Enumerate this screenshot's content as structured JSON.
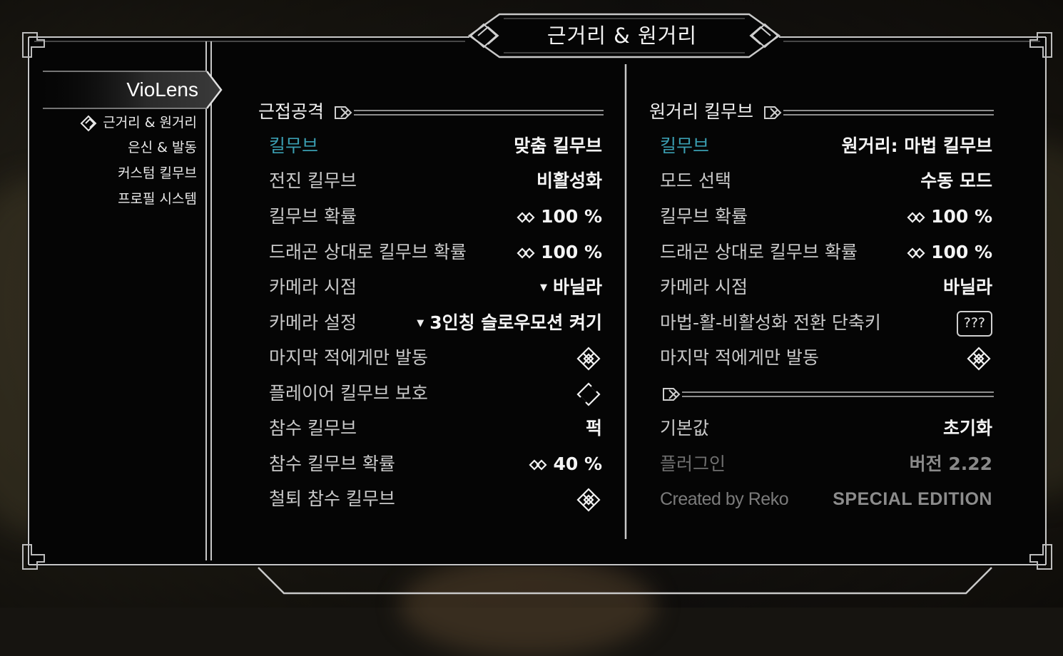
{
  "title": "근거리 & 원거리",
  "sidebar": {
    "brand": "VioLens",
    "items": [
      {
        "label": "근거리 & 원거리",
        "active": true
      },
      {
        "label": "은신 & 발동"
      },
      {
        "label": "커스텀 킬무브"
      },
      {
        "label": "프로필 시스템"
      }
    ]
  },
  "left_section": {
    "header": "근접공격",
    "rows": [
      {
        "label": "킬무브",
        "value": "맞춤 킬무브"
      },
      {
        "label": "전진 킬무브",
        "value": "비활성화"
      },
      {
        "label": "킬무브 확률",
        "value": "100 %"
      },
      {
        "label": "드래곤 상대로 킬무브 확률",
        "value": "100 %"
      },
      {
        "label": "카메라 시점",
        "value": "바닐라"
      },
      {
        "label": "카메라 설정",
        "value": "3인칭 슬로우모션 켜기"
      },
      {
        "label": "마지막 적에게만 발동",
        "value": ""
      },
      {
        "label": "플레이어 킬무브 보호",
        "value": ""
      },
      {
        "label": "참수 킬무브",
        "value": "퍽"
      },
      {
        "label": "참수 킬무브 확률",
        "value": "40 %"
      },
      {
        "label": "철퇴 참수 킬무브",
        "value": ""
      }
    ]
  },
  "right_section": {
    "header": "원거리 킬무브",
    "rows": [
      {
        "label": "킬무브",
        "value": "원거리: 마법 킬무브"
      },
      {
        "label": "모드 선택",
        "value": "수동 모드"
      },
      {
        "label": "킬무브 확률",
        "value": "100 %"
      },
      {
        "label": "드래곤 상대로 킬무브 확률",
        "value": "100 %"
      },
      {
        "label": "카메라 시점",
        "value": "바닐라"
      },
      {
        "label": "마법-활-비활성화 전환 단축키",
        "value": "???"
      },
      {
        "label": "마지막 적에게만 발동",
        "value": ""
      }
    ],
    "footer_rows": [
      {
        "label": "기본값",
        "value": "초기화"
      },
      {
        "label": "플러그인",
        "value": "버전 2.22"
      },
      {
        "label": "Created by Reko",
        "value": "SPECIAL EDITION"
      }
    ]
  },
  "icons": {
    "nav_active": "selected-diamond-icon",
    "slider": "slider-knot-icon",
    "dropdown": "dropdown-triangle-icon",
    "checkbox_checked": "checked-knot-icon",
    "checkbox_unchecked": "unchecked-diamond-icon"
  },
  "colors": {
    "highlight": "#3a9eb1",
    "panel": "#050505",
    "frame": "#c8c8c8"
  }
}
